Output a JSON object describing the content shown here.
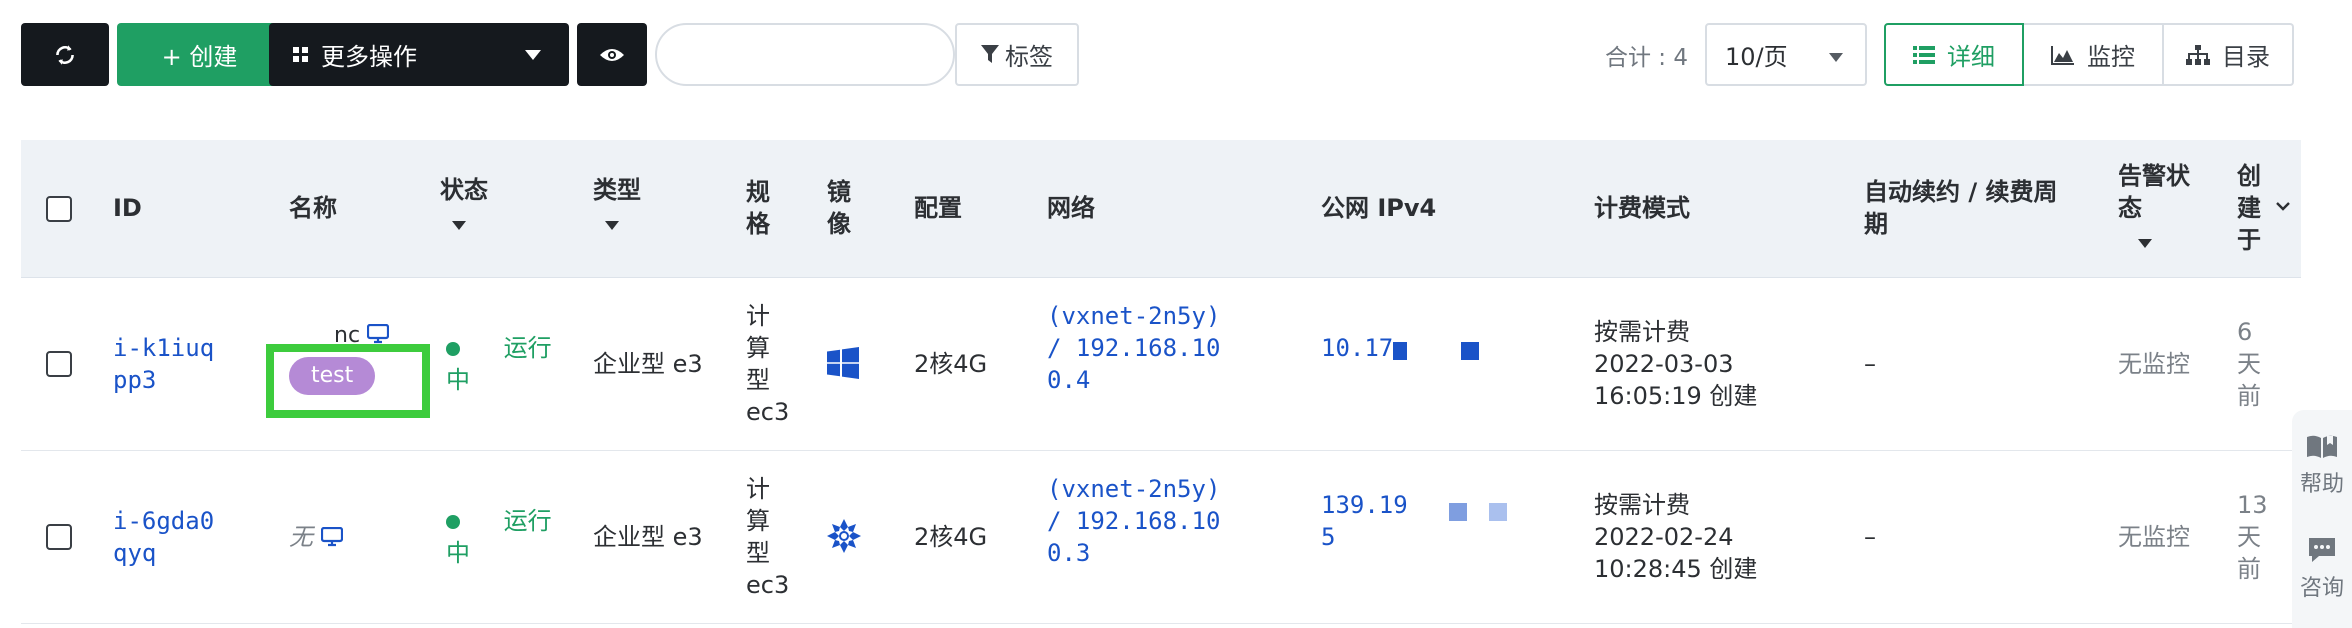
{
  "toolbar": {
    "refresh_icon": "refresh-icon",
    "create_label": "+ 创建",
    "more_label": "更多操作",
    "search_value": "",
    "search_placeholder": "",
    "tag_label": "标签",
    "total_label": "合计 : 4",
    "page_size": "10/页",
    "view_detail": "详细",
    "view_monitor": "监控",
    "view_catalog": "目录"
  },
  "table": {
    "headers": {
      "id": "ID",
      "name": "名称",
      "status": "状态",
      "type": "类型",
      "spec": [
        "规",
        "格"
      ],
      "image": [
        "镜",
        "像"
      ],
      "config": "配置",
      "network": "网络",
      "public_ip": "公网 IPv4",
      "billing": "计费模式",
      "renew": [
        "自动续约 / 续费周",
        "期"
      ],
      "alarm": [
        "告警状",
        "态"
      ],
      "created": [
        "创",
        "建",
        "于"
      ]
    },
    "rows": [
      {
        "id_lines": [
          "i-k1iuq",
          "pp3"
        ],
        "name": "nc",
        "tag": "test",
        "status_text": "运行",
        "status_suffix": "中",
        "type": "企业型 e3",
        "spec_lines": [
          "计",
          "算",
          "型",
          "ec3"
        ],
        "image_icon": "windows-icon",
        "config": "2核4G",
        "network_lines": [
          "(vxnet-2n5y)",
          "/ 192.168.10",
          "0.4"
        ],
        "public_ip_lines": [
          "10.17"
        ],
        "billing_lines": [
          "按需计费",
          "2022-03-03",
          "16:05:19 创建"
        ],
        "renew": "–",
        "alarm": "无监控",
        "created_lines": [
          "6",
          "天",
          "前"
        ]
      },
      {
        "id_lines": [
          "i-6gda0",
          "qyq"
        ],
        "name": "无",
        "tag": "",
        "status_text": "运行",
        "status_suffix": "中",
        "type": "企业型 e3",
        "spec_lines": [
          "计",
          "算",
          "型",
          "ec3"
        ],
        "image_icon": "snowflake-os-icon",
        "config": "2核4G",
        "network_lines": [
          "(vxnet-2n5y)",
          "/ 192.168.10",
          "0.3"
        ],
        "public_ip_lines": [
          "139.19",
          "5"
        ],
        "billing_lines": [
          "按需计费",
          "2022-02-24",
          "10:28:45 创建"
        ],
        "renew": "–",
        "alarm": "无监控",
        "created_lines": [
          "13",
          "天",
          "前"
        ]
      }
    ]
  },
  "side": {
    "help": "帮助",
    "consult": "咨询"
  },
  "colors": {
    "accent": "#1f9f63",
    "link": "#1a53c8",
    "dark": "#15191e",
    "tag": "#b58ad6",
    "highlight": "#3dcc3d"
  }
}
